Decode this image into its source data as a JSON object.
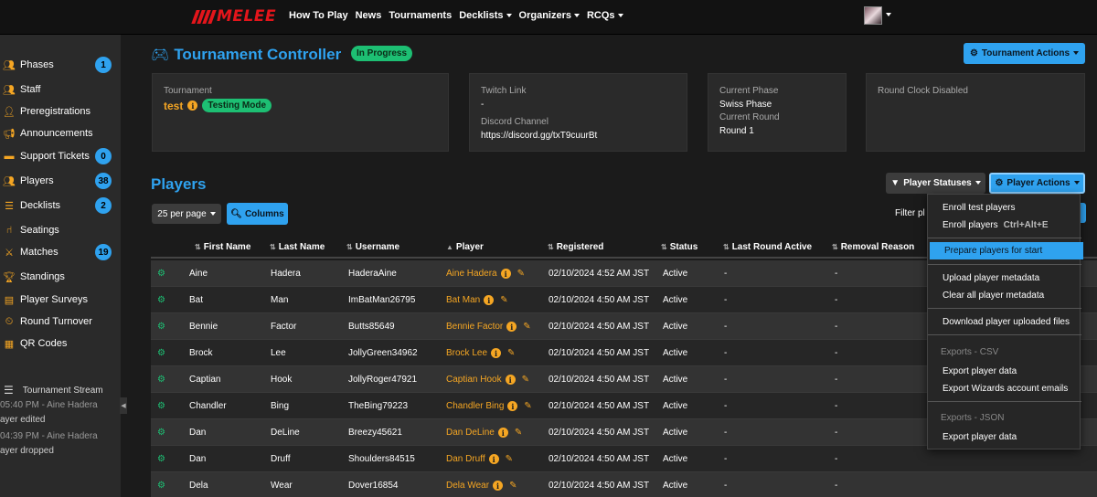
{
  "nav": {
    "logo": "MELEE",
    "links": [
      {
        "label": "How To Play",
        "dropdown": false
      },
      {
        "label": "News",
        "dropdown": false
      },
      {
        "label": "Tournaments",
        "dropdown": false
      },
      {
        "label": "Decklists",
        "dropdown": true
      },
      {
        "label": "Organizers",
        "dropdown": true
      },
      {
        "label": "RCQs",
        "dropdown": true
      }
    ]
  },
  "sidebar": {
    "items": [
      {
        "label": "Phases",
        "icon": "users-icon",
        "badge": "1"
      },
      {
        "label": "Staff",
        "icon": "staff-icon",
        "badge": ""
      },
      {
        "label": "Preregistrations",
        "icon": "user-plus-icon",
        "badge": ""
      },
      {
        "label": "Announcements",
        "icon": "megaphone-icon",
        "badge": ""
      },
      {
        "label": "Support Tickets",
        "icon": "ticket-icon",
        "badge": "0"
      },
      {
        "label": "Players",
        "icon": "players-icon",
        "badge": "38"
      },
      {
        "label": "Decklists",
        "icon": "list-icon",
        "badge": "2"
      },
      {
        "label": "Seatings",
        "icon": "chair-icon",
        "badge": ""
      },
      {
        "label": "Matches",
        "icon": "swords-icon",
        "badge": "19"
      },
      {
        "label": "Standings",
        "icon": "trophy-icon",
        "badge": ""
      },
      {
        "label": "Player Surveys",
        "icon": "clipboard-icon",
        "badge": ""
      },
      {
        "label": "Round Turnover",
        "icon": "clock-icon",
        "badge": ""
      },
      {
        "label": "QR Codes",
        "icon": "qrcode-icon",
        "badge": ""
      }
    ],
    "stream": {
      "title": "Tournament Stream",
      "entries": [
        {
          "time": "05:40 PM - Aine Hadera",
          "text": "ayer edited"
        },
        {
          "time": "04:39 PM - Aine Hadera",
          "text": "ayer dropped"
        }
      ]
    }
  },
  "header": {
    "title": "Tournament Controller",
    "status": "In Progress",
    "actions_label": "Tournament Actions"
  },
  "cards": {
    "tournament_label": "Tournament",
    "tournament_name": "test",
    "testing_mode": "Testing Mode",
    "twitch_label": "Twitch Link",
    "twitch_value": "-",
    "discord_label": "Discord Channel",
    "discord_value": "https://discord.gg/txT9cuurBt",
    "phase_label": "Current Phase",
    "phase_value": "Swiss Phase",
    "round_label": "Current Round",
    "round_value": "Round 1",
    "clock": "Round Clock Disabled"
  },
  "players": {
    "title": "Players",
    "per_page": "25 per page",
    "columns_btn": "Columns",
    "statuses_btn": "Player Statuses",
    "actions_btn": "Player Actions",
    "filter_label": "Filter pl",
    "headers": [
      "First Name",
      "Last Name",
      "Username",
      "Player",
      "Registered",
      "Status",
      "Last Round Active",
      "Removal Reason"
    ],
    "rows": [
      {
        "first": "Aine",
        "last": "Hadera",
        "username": "HaderaAine",
        "player": "Aine Hadera",
        "registered": "02/10/2024 4:52 AM JST",
        "status": "Active",
        "last_round": "-",
        "removal": "-"
      },
      {
        "first": "Bat",
        "last": "Man",
        "username": "ImBatMan26795",
        "player": "Bat Man",
        "registered": "02/10/2024 4:50 AM JST",
        "status": "Active",
        "last_round": "-",
        "removal": "-"
      },
      {
        "first": "Bennie",
        "last": "Factor",
        "username": "Butts85649",
        "player": "Bennie Factor",
        "registered": "02/10/2024 4:50 AM JST",
        "status": "Active",
        "last_round": "-",
        "removal": "-"
      },
      {
        "first": "Brock",
        "last": "Lee",
        "username": "JollyGreen34962",
        "player": "Brock Lee",
        "registered": "02/10/2024 4:50 AM JST",
        "status": "Active",
        "last_round": "-",
        "removal": "-"
      },
      {
        "first": "Captian",
        "last": "Hook",
        "username": "JollyRoger47921",
        "player": "Captian Hook",
        "registered": "02/10/2024 4:50 AM JST",
        "status": "Active",
        "last_round": "-",
        "removal": "-"
      },
      {
        "first": "Chandler",
        "last": "Bing",
        "username": "TheBing79223",
        "player": "Chandler Bing",
        "registered": "02/10/2024 4:50 AM JST",
        "status": "Active",
        "last_round": "-",
        "removal": "-"
      },
      {
        "first": "Dan",
        "last": "DeLine",
        "username": "Breezy45621",
        "player": "Dan DeLine",
        "registered": "02/10/2024 4:50 AM JST",
        "status": "Active",
        "last_round": "-",
        "removal": "-"
      },
      {
        "first": "Dan",
        "last": "Druff",
        "username": "Shoulders84515",
        "player": "Dan Druff",
        "registered": "02/10/2024 4:50 AM JST",
        "status": "Active",
        "last_round": "-",
        "removal": "-"
      },
      {
        "first": "Dela",
        "last": "Wear",
        "username": "Dover16854",
        "player": "Dela Wear",
        "registered": "02/10/2024 4:50 AM JST",
        "status": "Active",
        "last_round": "-",
        "removal": "-"
      }
    ]
  },
  "menu": {
    "enroll_test": "Enroll test players",
    "enroll": "Enroll players",
    "enroll_shortcut": "Ctrl+Alt+E",
    "prepare": "Prepare players for start",
    "upload_meta": "Upload player metadata",
    "clear_meta": "Clear all player metadata",
    "download_files": "Download player uploaded files",
    "csv_header": "Exports - CSV",
    "export_data_csv": "Export player data",
    "export_wizards": "Export Wizards account emails",
    "json_header": "Exports - JSON",
    "export_data_json": "Export player data"
  },
  "colors": {
    "accent_blue": "#2fa2ef",
    "accent_orange": "#f5a623",
    "accent_green": "#1dbf73",
    "brand_red": "#e4151b"
  }
}
